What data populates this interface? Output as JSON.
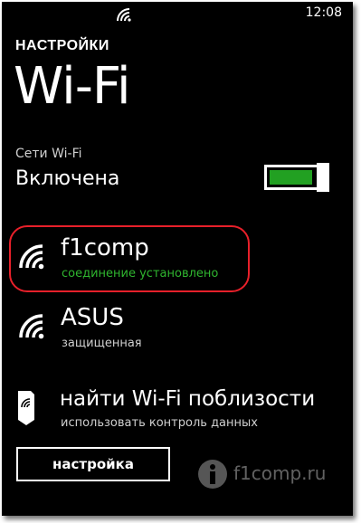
{
  "status_bar": {
    "clock": "12:08",
    "wifi_icon": "wifi-signal-icon"
  },
  "header": {
    "app_title": "НАСТРОЙКИ",
    "page_title": "Wi-Fi"
  },
  "wifi_toggle": {
    "label": "Сети Wi-Fi",
    "state": "Включена",
    "on": true,
    "on_color": "#22a022"
  },
  "networks": [
    {
      "name": "f1comp",
      "status": "соединение установлено",
      "status_color": "#2fb52f",
      "icon": "wifi-signal-icon",
      "highlighted": true,
      "highlight_color": "#e8202a"
    },
    {
      "name": "ASUS",
      "status": "защищенная",
      "icon": "wifi-signal-icon"
    }
  ],
  "find_nearby": {
    "title": "найти Wi-Fi поблизости",
    "subtitle": "использовать контроль данных",
    "icon": "tag-icon"
  },
  "settings_button": {
    "label": "настройка"
  },
  "watermark": {
    "text": "f1comp.ru",
    "icon": "info-icon"
  }
}
